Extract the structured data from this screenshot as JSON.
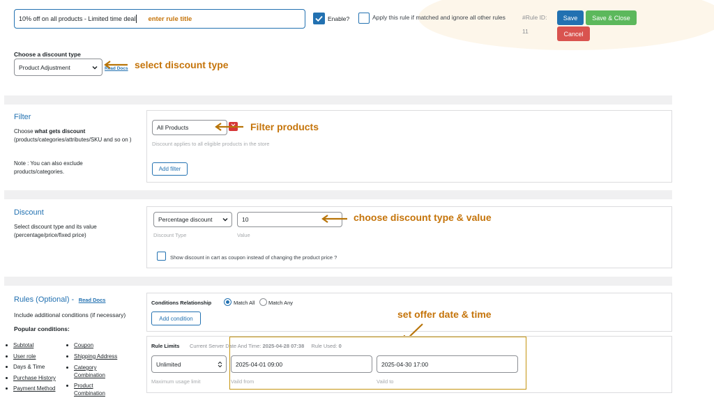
{
  "header": {
    "rule_title_value": "10% off on all products - Limited time deal",
    "enable_label": "Enable?",
    "apply_rule_label": "Apply this rule if matched and ignore all other rules",
    "rule_id_label": "#Rule ID:",
    "rule_id_value": "11",
    "save_label": "Save",
    "save_close_label": "Save & Close",
    "cancel_label": "Cancel"
  },
  "discount_type": {
    "label": "Choose a discount type",
    "selected": "Product Adjustment",
    "read_docs": "Read Docs"
  },
  "filter": {
    "title": "Filter",
    "desc_prefix": "Choose ",
    "desc_bold": "what gets discount",
    "desc_suffix": " (products/categories/attributes/SKU and so on )",
    "note": "Note : You can also exclude products/categories.",
    "selected": "All Products",
    "hint": "Discount applies to all eligible products in the store",
    "add_filter": "Add filter"
  },
  "discount": {
    "title": "Discount",
    "desc": "Select discount type and its value (percentage/price/fixed price)",
    "type_selected": "Percentage discount",
    "type_caption": "Discount Type",
    "value": "10",
    "value_caption": "Value",
    "coupon_label": "Show discount in cart as coupon instead of changing the product price ?"
  },
  "rules": {
    "title": "Rules (Optional) -",
    "read_docs": "Read Docs",
    "desc": "Include additional conditions (if necessary)",
    "popular_heading": "Popular conditions:",
    "popular_left": [
      "Subtotal",
      "User role",
      "Days & Time",
      "Purchase History",
      "Payment Method"
    ],
    "popular_right": [
      "Coupon",
      "Shipping Address",
      "Category Combination",
      "Product Combination"
    ],
    "conditions_relationship": "Conditions Relationship",
    "match_all": "Match All",
    "match_any": "Match Any",
    "add_condition": "Add condition",
    "rule_limits": "Rule Limits",
    "server_time_label": "Current Server Date And Time:",
    "server_time_value": "2025-04-28 07:38",
    "rule_used_label": "Rule Used:",
    "rule_used_value": "0",
    "limit_selected": "Unlimited",
    "limit_caption": "Maximum usage limit",
    "valid_from": "2025-04-01 09:00",
    "valid_from_caption": "Vaild from",
    "valid_to": "2025-04-30 17:00",
    "valid_to_caption": "Vaild to"
  },
  "annotations": {
    "rule_title": "enter rule title",
    "discount_type": "select discount type",
    "filter": "Filter products",
    "discount": "choose discount type & value",
    "date": "set offer date & time"
  },
  "colors": {
    "accent": "#2271b1",
    "save_close": "#5cb85c",
    "cancel": "#d9534f",
    "annotation": "#c5740a"
  }
}
